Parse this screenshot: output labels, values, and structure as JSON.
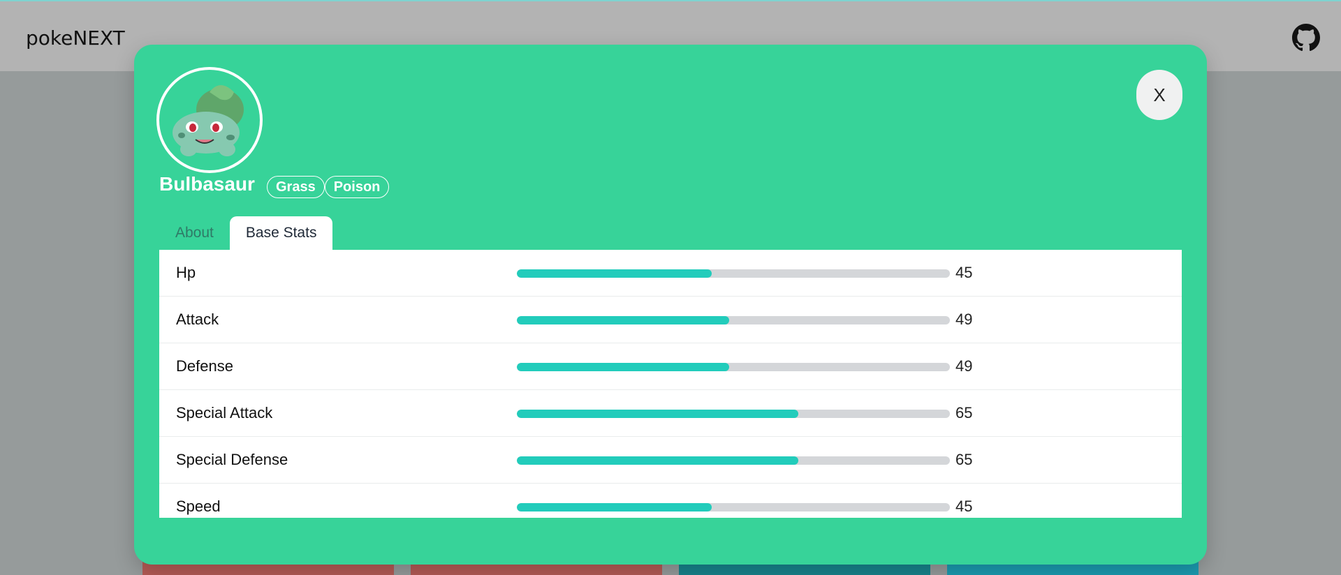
{
  "app": {
    "brand": "pokeNEXT",
    "github_icon": "github-icon"
  },
  "modal": {
    "close_label": "X",
    "pokemon": {
      "name": "Bulbasaur",
      "types": [
        "Grass",
        "Poison"
      ]
    },
    "tabs": [
      {
        "label": "About",
        "active": false
      },
      {
        "label": "Base Stats",
        "active": true
      }
    ],
    "stats": [
      {
        "label": "Hp",
        "value": "45",
        "fraction": 0.45
      },
      {
        "label": "Attack",
        "value": "49",
        "fraction": 0.49
      },
      {
        "label": "Defense",
        "value": "49",
        "fraction": 0.49
      },
      {
        "label": "Special Attack",
        "value": "65",
        "fraction": 0.65
      },
      {
        "label": "Special Defense",
        "value": "65",
        "fraction": 0.65
      },
      {
        "label": "Speed",
        "value": "45",
        "fraction": 0.45
      }
    ]
  },
  "colors": {
    "modal_bg": "#37d399",
    "stat_fill": "#22ccbb",
    "stat_track": "#d4d6d9"
  }
}
